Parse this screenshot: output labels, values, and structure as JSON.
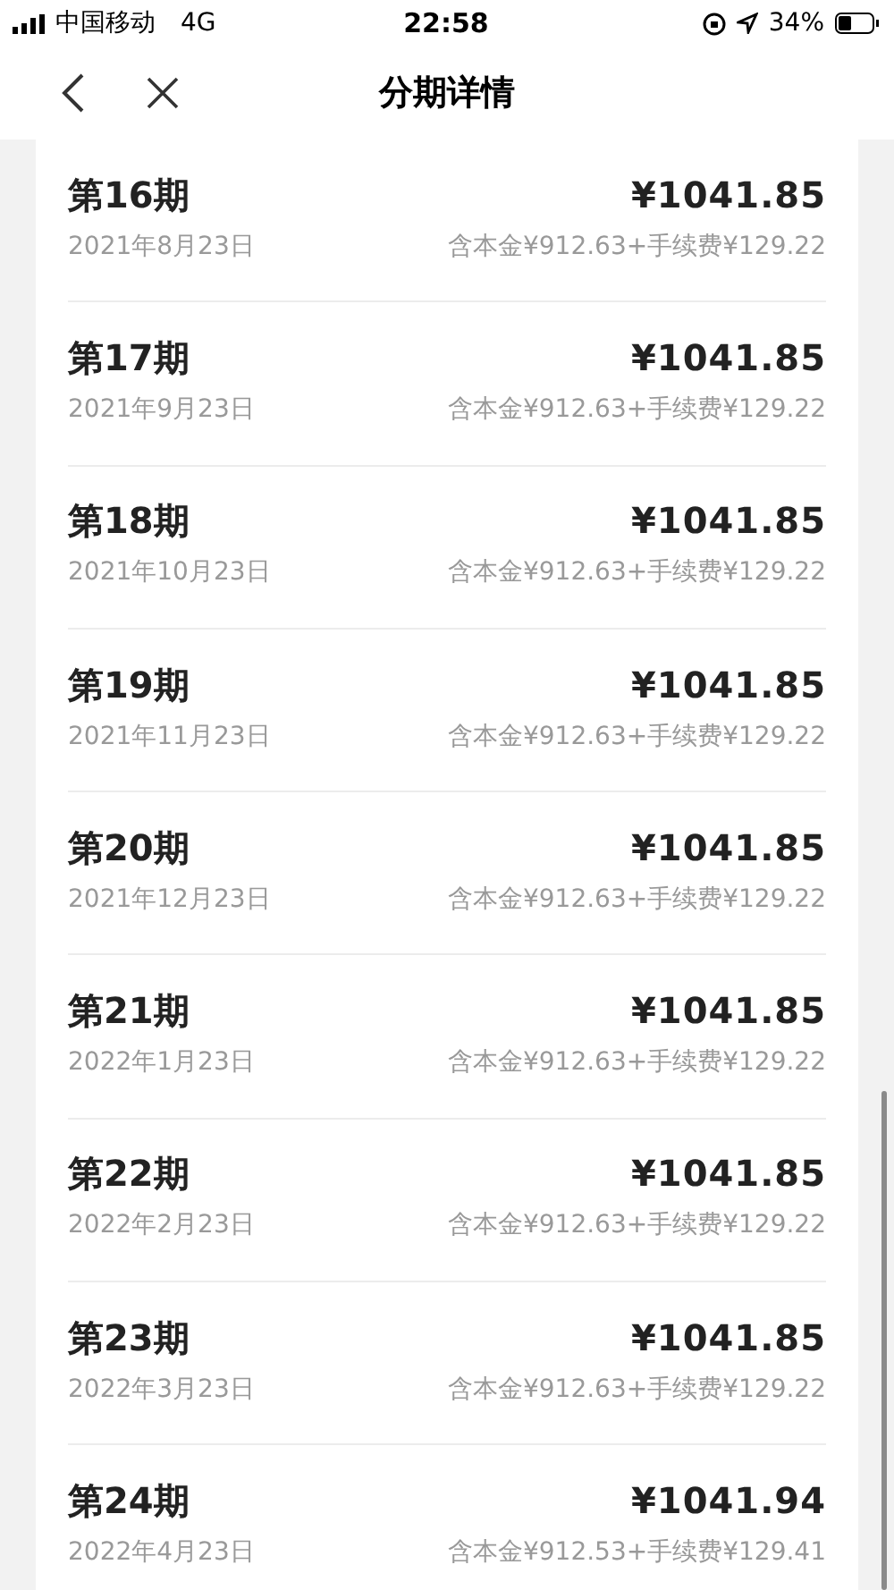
{
  "status_bar": {
    "carrier": "中国移动",
    "network": "4G",
    "time": "22:58",
    "battery": "34%"
  },
  "nav": {
    "title": "分期详情"
  },
  "installments": [
    {
      "period": "第16期",
      "amount": "¥1041.85",
      "date": "2021年8月23日",
      "detail": "含本金¥912.63+手续费¥129.22"
    },
    {
      "period": "第17期",
      "amount": "¥1041.85",
      "date": "2021年9月23日",
      "detail": "含本金¥912.63+手续费¥129.22"
    },
    {
      "period": "第18期",
      "amount": "¥1041.85",
      "date": "2021年10月23日",
      "detail": "含本金¥912.63+手续费¥129.22"
    },
    {
      "period": "第19期",
      "amount": "¥1041.85",
      "date": "2021年11月23日",
      "detail": "含本金¥912.63+手续费¥129.22"
    },
    {
      "period": "第20期",
      "amount": "¥1041.85",
      "date": "2021年12月23日",
      "detail": "含本金¥912.63+手续费¥129.22"
    },
    {
      "period": "第21期",
      "amount": "¥1041.85",
      "date": "2022年1月23日",
      "detail": "含本金¥912.63+手续费¥129.22"
    },
    {
      "period": "第22期",
      "amount": "¥1041.85",
      "date": "2022年2月23日",
      "detail": "含本金¥912.63+手续费¥129.22"
    },
    {
      "period": "第23期",
      "amount": "¥1041.85",
      "date": "2022年3月23日",
      "detail": "含本金¥912.63+手续费¥129.22"
    },
    {
      "period": "第24期",
      "amount": "¥1041.94",
      "date": "2022年4月23日",
      "detail": "含本金¥912.53+手续费¥129.41"
    }
  ]
}
